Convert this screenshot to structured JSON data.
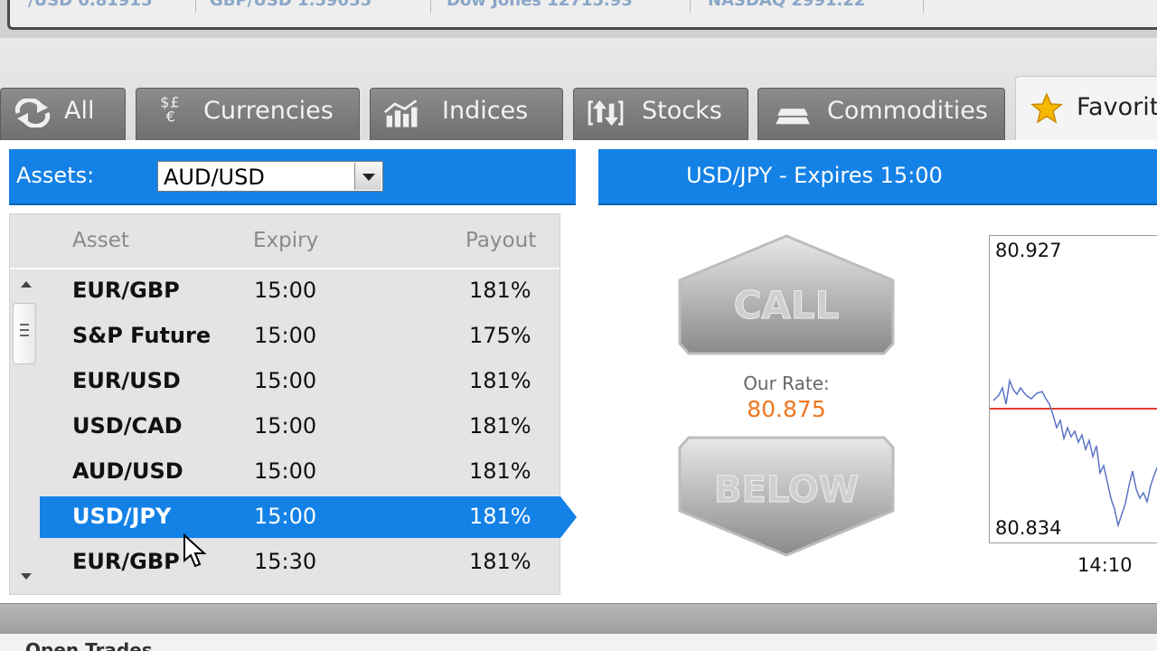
{
  "ticker": [
    {
      "text": "/USD  0.81915"
    },
    {
      "text": "GBP/USD  1.59055"
    },
    {
      "text": "Dow Jones  12715.93"
    },
    {
      "text": "NASDAQ  2991.22"
    }
  ],
  "tabs": [
    {
      "label": "All",
      "icon": "refresh-arrows-icon"
    },
    {
      "label": "Currencies",
      "icon": "currency-symbols-icon"
    },
    {
      "label": "Indices",
      "icon": "indices-chart-icon"
    },
    {
      "label": "Stocks",
      "icon": "stocks-arrows-icon"
    },
    {
      "label": "Commodities",
      "icon": "gold-bars-icon"
    },
    {
      "label": "Favorit",
      "icon": "star-icon",
      "active": true
    }
  ],
  "assets_filter": {
    "label": "Assets:",
    "selected": "AUD/USD"
  },
  "table": {
    "headers": {
      "asset": "Asset",
      "expiry": "Expiry",
      "payout": "Payout"
    },
    "rows": [
      {
        "asset": "EUR/GBP",
        "expiry": "15:00",
        "payout": "181%"
      },
      {
        "asset": "S&P Future",
        "expiry": "15:00",
        "payout": "175%"
      },
      {
        "asset": "EUR/USD",
        "expiry": "15:00",
        "payout": "181%"
      },
      {
        "asset": "USD/CAD",
        "expiry": "15:00",
        "payout": "181%"
      },
      {
        "asset": "AUD/USD",
        "expiry": "15:00",
        "payout": "181%"
      },
      {
        "asset": "USD/JPY",
        "expiry": "15:00",
        "payout": "181%",
        "selected": true
      },
      {
        "asset": "EUR/GBP",
        "expiry": "15:30",
        "payout": "181%"
      }
    ]
  },
  "trade": {
    "title": "USD/JPY - Expires 15:00",
    "call_label": "CALL",
    "put_label": "BELOW",
    "rate_label": "Our Rate:",
    "rate_value": "80.875"
  },
  "mini_chart": {
    "y_max": "80.927",
    "y_min": "80.834",
    "x_label": "14:10",
    "reference_rate": 80.875
  },
  "bottom": {
    "text": "Open Trades"
  },
  "colors": {
    "accent": "#1481e6",
    "rate": "#f07820",
    "strike_line": "#e04030"
  }
}
